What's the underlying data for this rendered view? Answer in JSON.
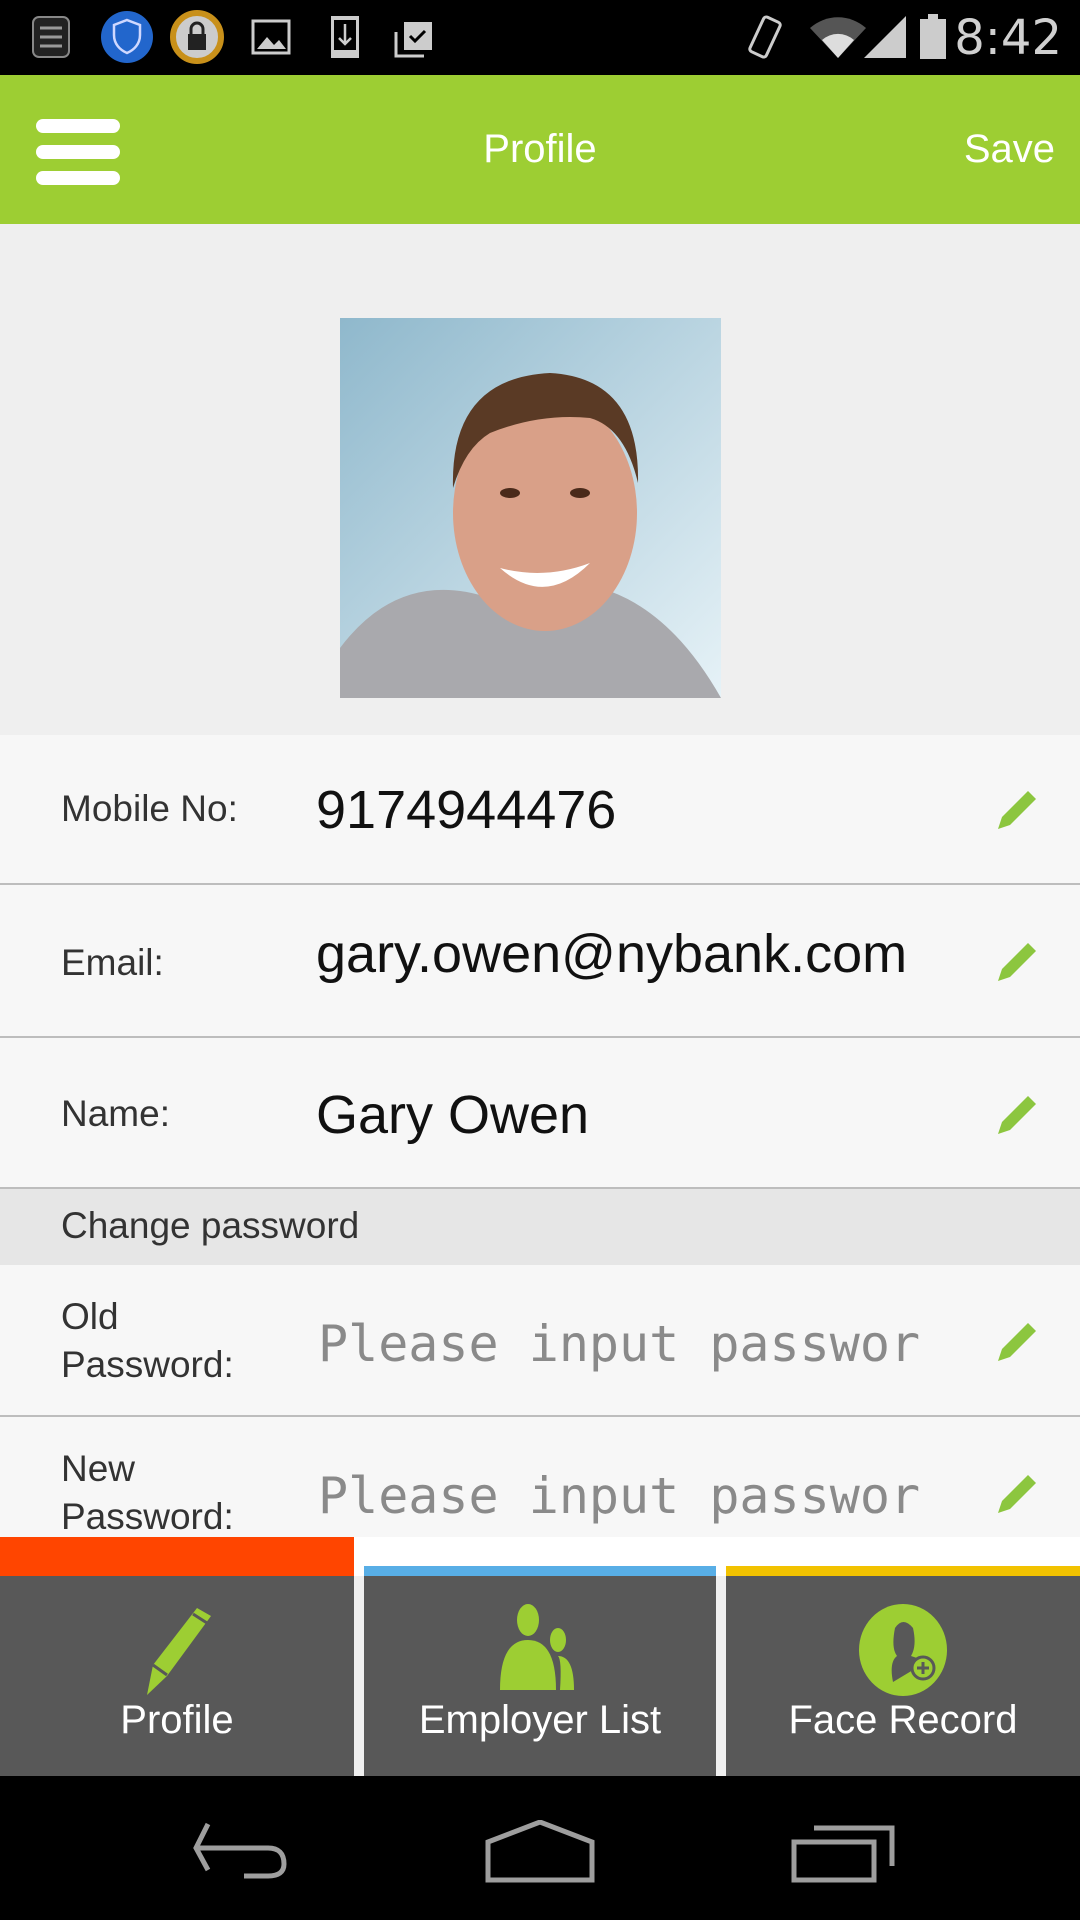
{
  "status_bar": {
    "time": "8:42",
    "icons": [
      "notes-icon",
      "shield-phone-icon",
      "lock-icon",
      "image-icon",
      "download-icon",
      "clipboard-check-icon",
      "vibrate-icon",
      "wifi-icon",
      "signal-icon",
      "battery-icon"
    ]
  },
  "header": {
    "title": "Profile",
    "save_label": "Save",
    "menu_icon": "hamburger-icon",
    "color": "#9dce33"
  },
  "profile": {
    "photo": "profile-photo"
  },
  "fields": [
    {
      "label": "Mobile No:",
      "value": "9174944476"
    },
    {
      "label": "Email:",
      "value": "gary.owen@nybank.com"
    },
    {
      "label": "Name:",
      "value": "Gary Owen"
    }
  ],
  "password_section": {
    "title": "Change password",
    "fields": [
      {
        "label_line1": "Old",
        "label_line2": "Password:",
        "placeholder": "Please input passwor"
      },
      {
        "label_line1": "New",
        "label_line2": "Password:",
        "placeholder": "Please input passwor"
      }
    ]
  },
  "tabs": [
    {
      "label": "Profile",
      "icon": "pencil-icon",
      "accent": "#ff4500",
      "active": true
    },
    {
      "label": "Employer List",
      "icon": "users-icon",
      "accent": "#58aee6",
      "active": false
    },
    {
      "label": "Face Record",
      "icon": "add-user-icon",
      "accent": "#f2c200",
      "active": false
    }
  ],
  "nav_bar": {
    "icons": [
      "back-icon",
      "home-icon",
      "recents-icon"
    ]
  }
}
